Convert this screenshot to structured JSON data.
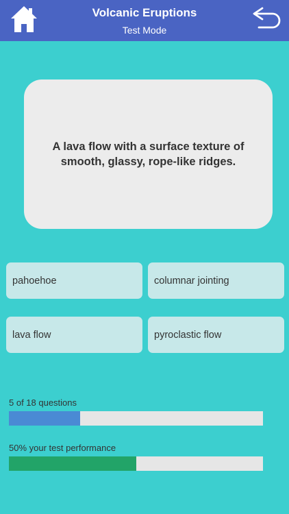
{
  "header": {
    "title": "Volcanic Eruptions",
    "subtitle": "Test Mode",
    "home_icon": "home-icon",
    "back_icon": "back-arrow-icon",
    "color": "#4a64c3"
  },
  "question": {
    "text": "A lava flow with a surface texture of smooth, glassy, rope-like ridges."
  },
  "answers": [
    {
      "label": "pahoehoe"
    },
    {
      "label": "columnar jointing"
    },
    {
      "label": "lava flow"
    },
    {
      "label": "pyroclastic flow"
    }
  ],
  "progress": {
    "label": "5 of 18 questions",
    "current": 5,
    "total": 18,
    "fraction": 0.28,
    "color": "#4a8ad4"
  },
  "performance": {
    "label": "50% your test performance",
    "percent": 50,
    "color": "#22a468"
  },
  "colors": {
    "background": "#3ccfcf",
    "card": "#ececec",
    "answer_bg": "#c7e8e9",
    "track": "#e6e6e6"
  }
}
